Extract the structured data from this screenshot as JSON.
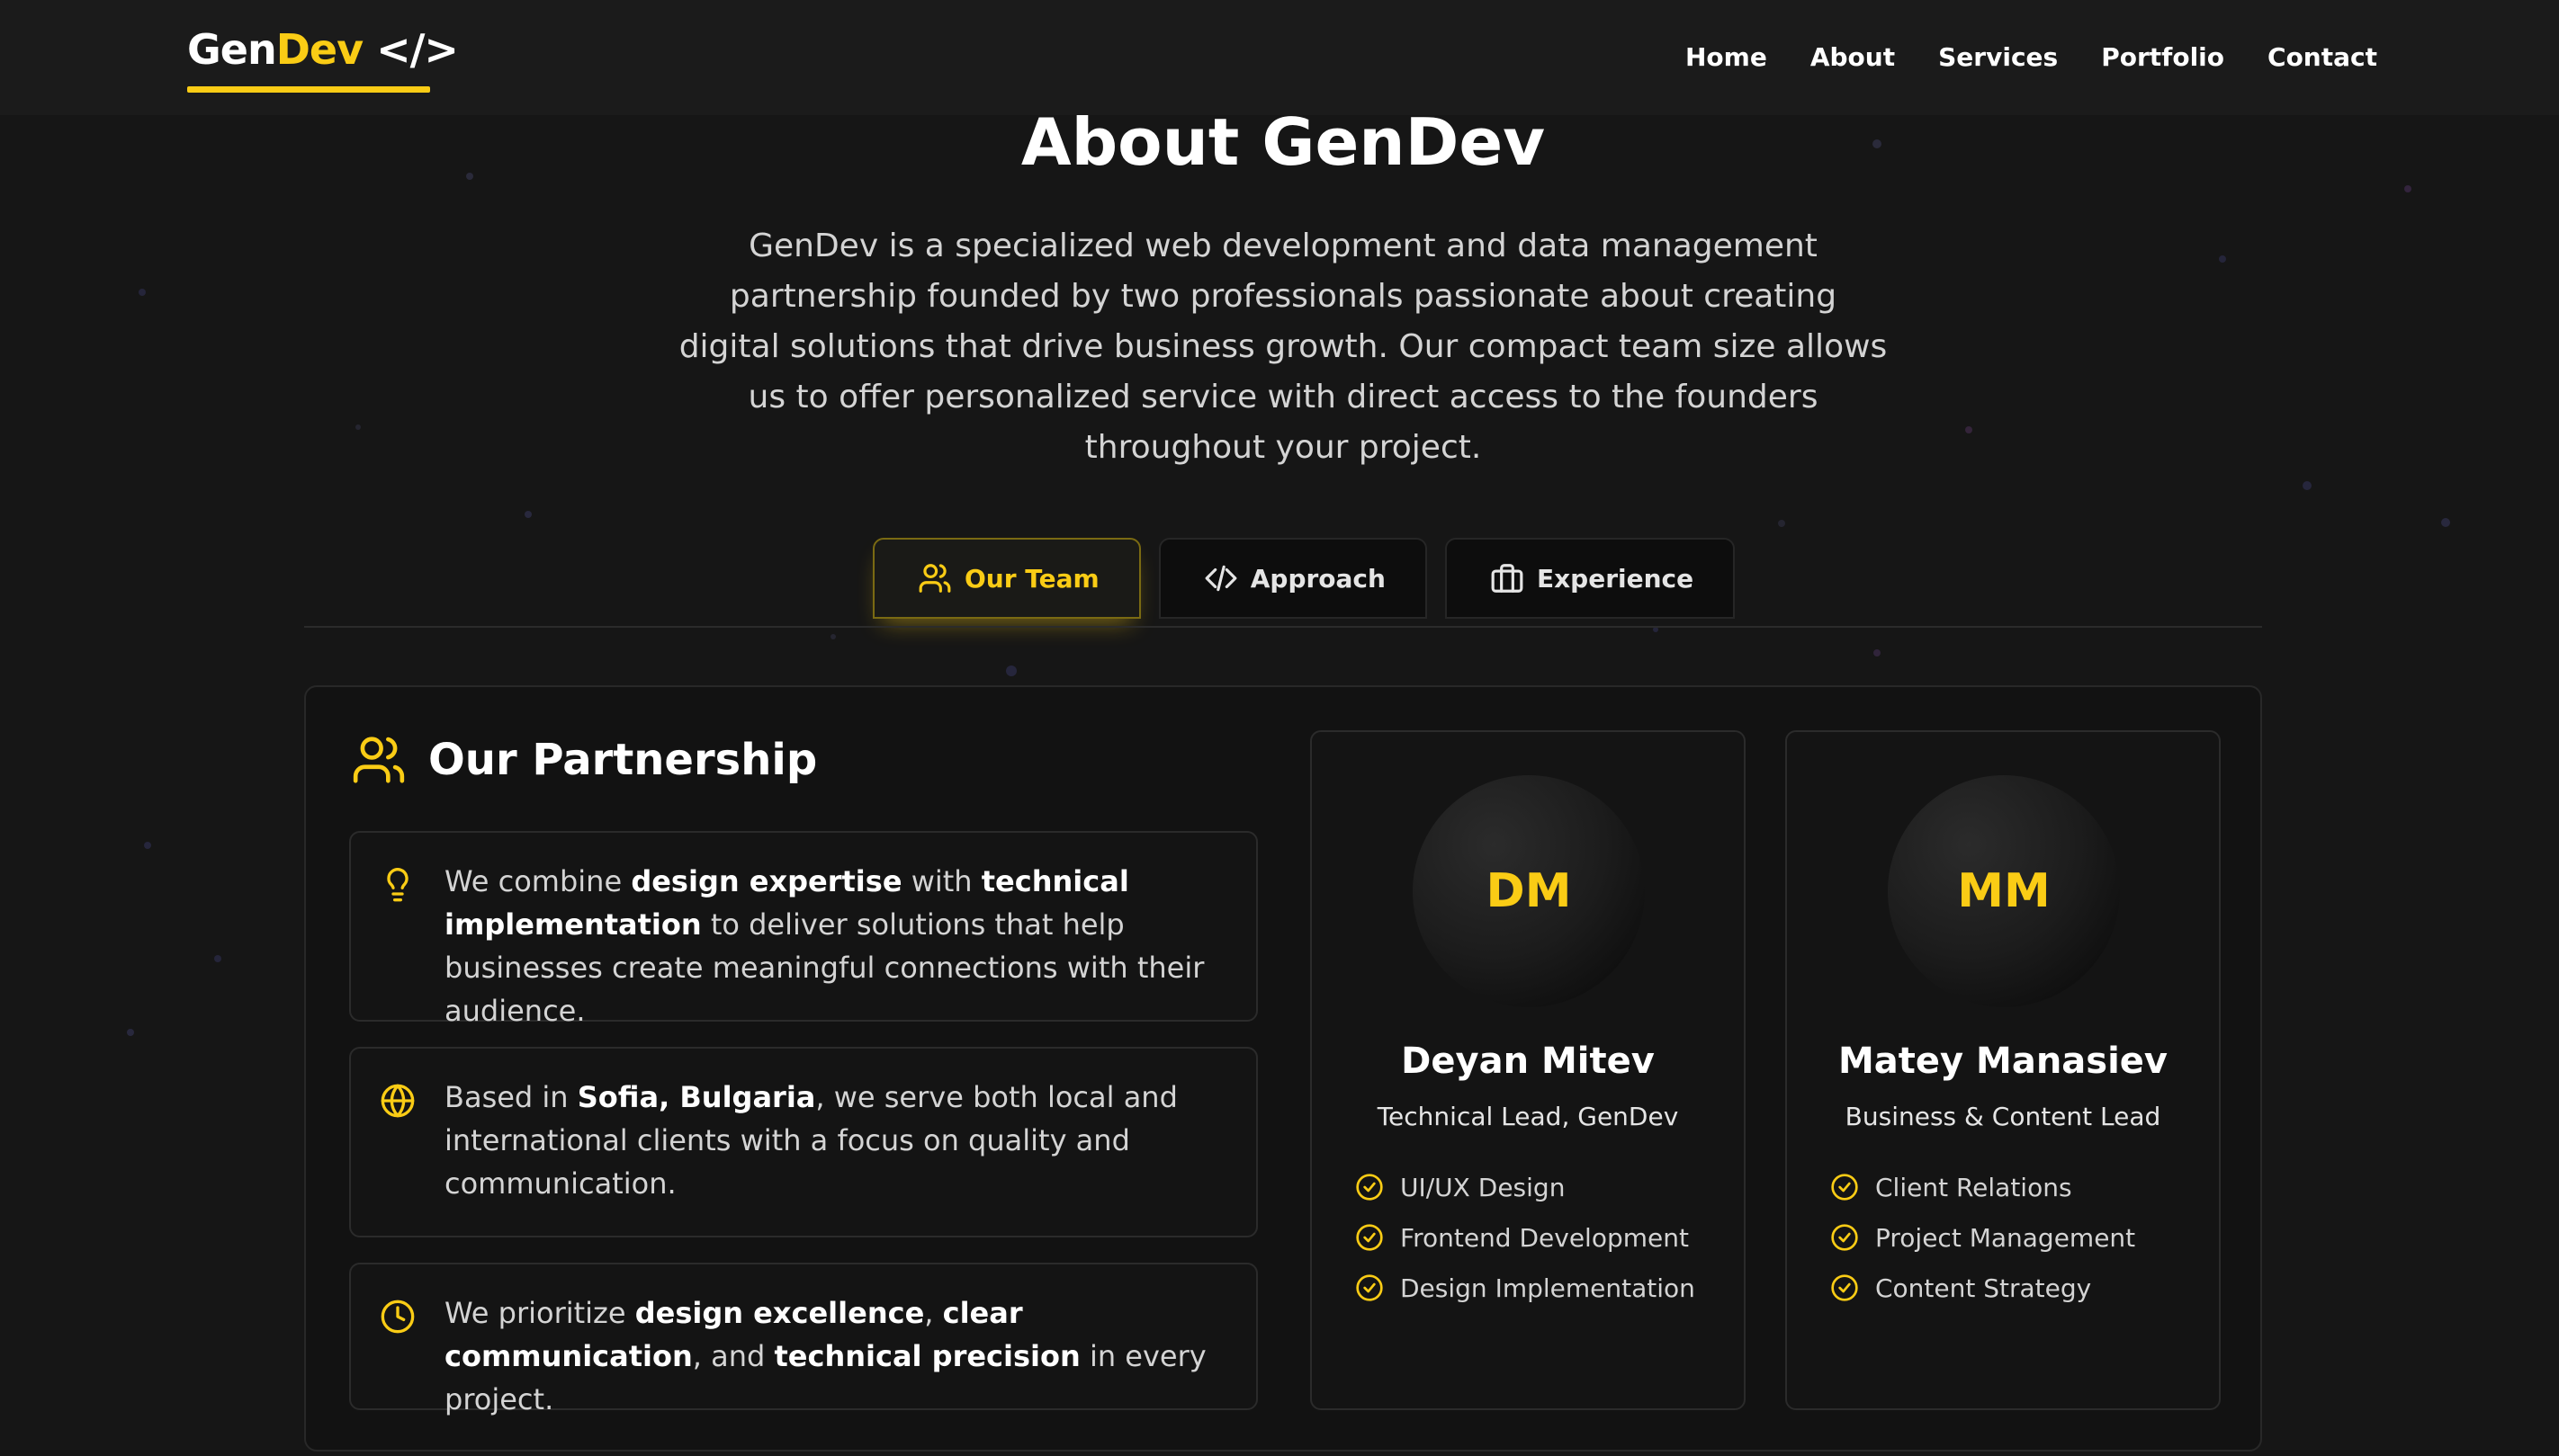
{
  "nav": {
    "logo": {
      "part1": "Gen",
      "part2": "Dev",
      "part3": " </>"
    },
    "links": [
      "Home",
      "About",
      "Services",
      "Portfolio",
      "Contact"
    ]
  },
  "hero": {
    "title": "About GenDev",
    "text": "GenDev is a specialized web development and data management partnership founded by two professionals passionate about creating digital solutions that drive business growth. Our compact team size allows us to offer personalized service with direct access to the founders throughout your project."
  },
  "tabs": [
    {
      "label": "Our Team",
      "icon": "users-icon",
      "active": true
    },
    {
      "label": "Approach",
      "icon": "code-icon",
      "active": false
    },
    {
      "label": "Experience",
      "icon": "briefcase-icon",
      "active": false
    }
  ],
  "partnership": {
    "title": "Our Partnership",
    "icon": "users-icon",
    "cards": [
      {
        "icon": "lightbulb-icon",
        "s0": "We combine ",
        "b1": "design expertise",
        "s2": " with ",
        "b3": "technical implementation",
        "s4": " to deliver solutions that help businesses create meaningful connections with their audience."
      },
      {
        "icon": "globe-icon",
        "s0": "Based in ",
        "b1": "Sofia, Bulgaria",
        "s2": ", we serve both local and international clients with a focus on quality and communication."
      },
      {
        "icon": "clock-icon",
        "s0": "We prioritize ",
        "b1": "design excellence",
        "s2": ", ",
        "b3": "clear communication",
        "s4": ", and ",
        "b5": "technical precision",
        "s6": " in every project."
      }
    ]
  },
  "team": [
    {
      "initials": "DM",
      "name": "Deyan Mitev",
      "role": "Technical Lead, GenDev",
      "skills": [
        "UI/UX Design",
        "Frontend Development",
        "Design Implementation"
      ]
    },
    {
      "initials": "MM",
      "name": "Matey Manasiev",
      "role": "Business & Content Lead",
      "skills": [
        "Client Relations",
        "Project Management",
        "Content Strategy"
      ]
    }
  ],
  "colors": {
    "accent": "#facc15",
    "background": "#161616",
    "panel": "#121212",
    "border": "#2b2b2b"
  }
}
